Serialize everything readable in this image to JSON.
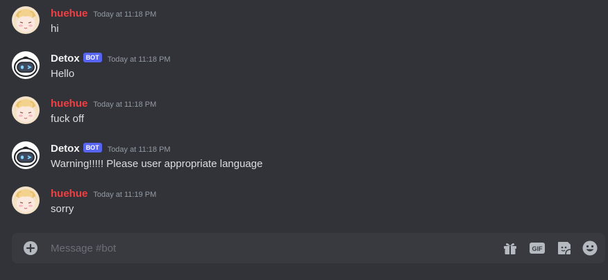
{
  "messages": [
    {
      "author": "huehue",
      "is_bot": false,
      "timestamp": "Today at 11:18 PM",
      "content": "hi",
      "avatar": "anime-girl-avatar"
    },
    {
      "author": "Detox",
      "is_bot": true,
      "bot_tag": "BOT",
      "timestamp": "Today at 11:18 PM",
      "content": "Hello",
      "avatar": "robot-avatar"
    },
    {
      "author": "huehue",
      "is_bot": false,
      "timestamp": "Today at 11:18 PM",
      "content": "fuck off",
      "avatar": "anime-girl-avatar"
    },
    {
      "author": "Detox",
      "is_bot": true,
      "bot_tag": "BOT",
      "timestamp": "Today at 11:18 PM",
      "content": "Warning!!!!! Please user appropriate language",
      "avatar": "robot-avatar"
    },
    {
      "author": "huehue",
      "is_bot": false,
      "timestamp": "Today at 11:19 PM",
      "content": "sorry",
      "avatar": "anime-girl-avatar"
    }
  ],
  "composer": {
    "placeholder": "Message #bot",
    "value": "",
    "icons": [
      "plus-circle-icon",
      "gift-icon",
      "gif-icon",
      "sticker-icon",
      "emoji-icon"
    ],
    "gif_label": "GIF"
  },
  "colors": {
    "background": "#313338",
    "composer_background": "#383a40",
    "user_name": "#f23f43",
    "bot_name": "#f2f3f5",
    "bot_tag": "#5865f2",
    "timestamp": "#949ba4",
    "message_text": "#dbdee1",
    "icon": "#b5bac1"
  }
}
